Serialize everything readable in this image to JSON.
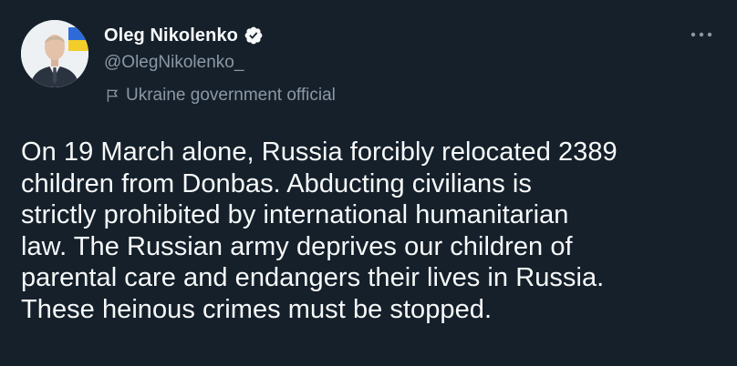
{
  "author": {
    "display_name": "Oleg Nikolenko",
    "handle": "@OlegNikolenko_",
    "label": "Ukraine government official",
    "verified_icon": "verified-badge-icon",
    "label_icon": "flag-icon"
  },
  "menu": {
    "icon": "more-options-icon",
    "glyph": "•••"
  },
  "tweet": {
    "lines": [
      "On 19 March alone, Russia forcibly relocated 2389",
      "children from Donbas. Abducting civilians is",
      "strictly prohibited by international humanitarian",
      "law. The Russian army deprives our children of",
      "parental care and endangers their lives in Russia.",
      "These heinous crimes must be stopped."
    ]
  },
  "colors": {
    "background": "#15202b",
    "text_primary": "#f7f9f9",
    "text_secondary": "#8b98a5"
  }
}
